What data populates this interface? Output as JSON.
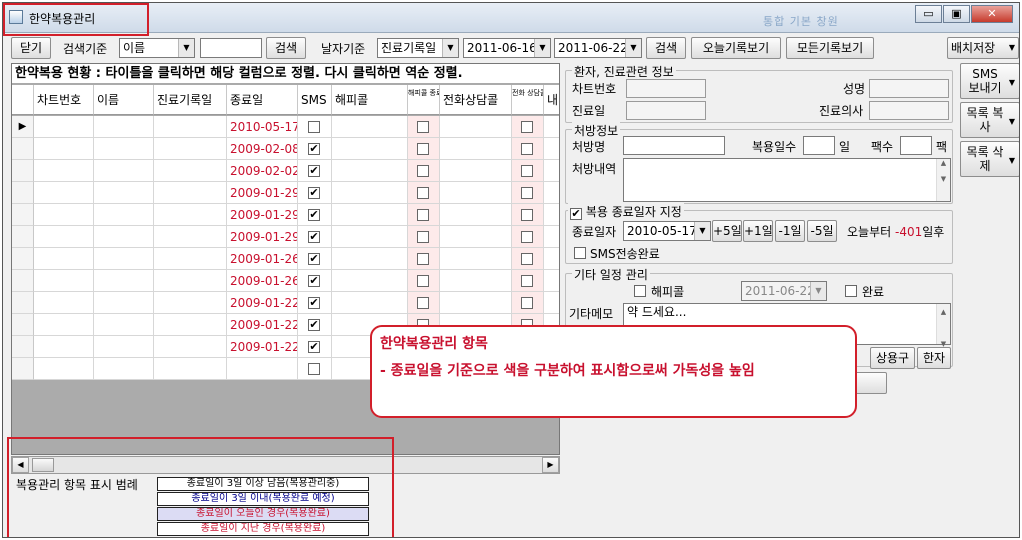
{
  "window": {
    "title": "한약복용관리",
    "ghost_title": "통합 기본 창원",
    "min_label": "▭",
    "max_label": "▣",
    "close_label": "✕"
  },
  "toolbar": {
    "close_btn": "닫기",
    "search_key_label": "검색기준",
    "search_key_value": "이름",
    "search_input": "",
    "search_btn": "검색",
    "date_key_label": "날자기준",
    "date_key_value": "진료기록일",
    "date_from": "2011-06-16",
    "date_to": "2011-06-22",
    "search_btn2": "검색",
    "today_btn": "오늘기록보기",
    "all_btn": "모든기록보기",
    "batch_btn": "배치저장"
  },
  "grid": {
    "caption": "한약복용 현황 : 타이틀을 클릭하면 해당 컬럼으로 정렬. 다시 클릭하면 역순 정렬.",
    "headers": {
      "chart": "차트번호",
      "name": "이름",
      "visit": "진료기록일",
      "end": "종료일",
      "sms": "SMS",
      "happy": "해피콜",
      "happy_done": "해피콜 종료",
      "phone": "전화상담콜",
      "phone_done": "전화 상담콜 종료",
      "extra": "내"
    },
    "rows": [
      {
        "end": "2010-05-17",
        "sms": false,
        "selected": true
      },
      {
        "end": "2009-02-08",
        "sms": true
      },
      {
        "end": "2009-02-02",
        "sms": true
      },
      {
        "end": "2009-01-29",
        "sms": true
      },
      {
        "end": "2009-01-29",
        "sms": true
      },
      {
        "end": "2009-01-29",
        "sms": true
      },
      {
        "end": "2009-01-26",
        "sms": true
      },
      {
        "end": "2009-01-26",
        "sms": true
      },
      {
        "end": "2009-01-22",
        "sms": true
      },
      {
        "end": "2009-01-22",
        "sms": true
      },
      {
        "end": "2009-01-22",
        "sms": true
      },
      {
        "end": "",
        "sms": false
      }
    ]
  },
  "legend": {
    "title": "복용관리 항목 표시 범례",
    "items": [
      {
        "text": "종료일이 3일 이상 남음(복용관리중)",
        "color": "#000000",
        "bg": "#ffffff"
      },
      {
        "text": "종료일이 3일 이내(복용완료 예정)",
        "color": "#00008b",
        "bg": "#ffffff"
      },
      {
        "text": "종료일이 오늘인 경우(복용완료)",
        "color": "#c8102e",
        "bg": "#dcdcf4"
      },
      {
        "text": "종료일이 지난 경우(복용완료)",
        "color": "#c8102e",
        "bg": "#ffffff"
      }
    ]
  },
  "patient": {
    "title": "환자, 진료관련 정보",
    "chart_label": "차트번호",
    "name_label": "성명",
    "visit_label": "진료일",
    "doctor_label": "진료의사"
  },
  "prescription": {
    "title": "처방정보",
    "name_label": "처방명",
    "days_label": "복용일수",
    "days_unit": "일",
    "packs_label": "팩수",
    "packs_unit": "팩",
    "detail_label": "처방내역"
  },
  "enddate": {
    "title": "복용 종료일자 지정",
    "end_label": "종료일자",
    "end_value": "2010-05-17",
    "plus5": "+5일",
    "plus1": "+1일",
    "minus1": "-1일",
    "minus5": "-5일",
    "today_from": "오늘부터",
    "today_days": "-401",
    "today_suffix": "일후",
    "sms_done": "SMS전송완료"
  },
  "etc": {
    "title": "기타 일정 관리",
    "happy_label": "해피콜",
    "happy_date": "2011-06-22",
    "done_label": "완료",
    "memo_label": "기타메모",
    "memo_text": "약 드세요...",
    "phrase_btn": "상용구",
    "hanja_btn": "한자"
  },
  "side": {
    "sms_btn": "SMS 보내기",
    "copy_btn": "목록 복사",
    "delete_btn": "목록 삭제"
  },
  "callout": {
    "line1": "한약복용관리 항목",
    "line2": "- 종료일을 기준으로 색을 구분하여 표시함으로써 가독성을 높임"
  }
}
